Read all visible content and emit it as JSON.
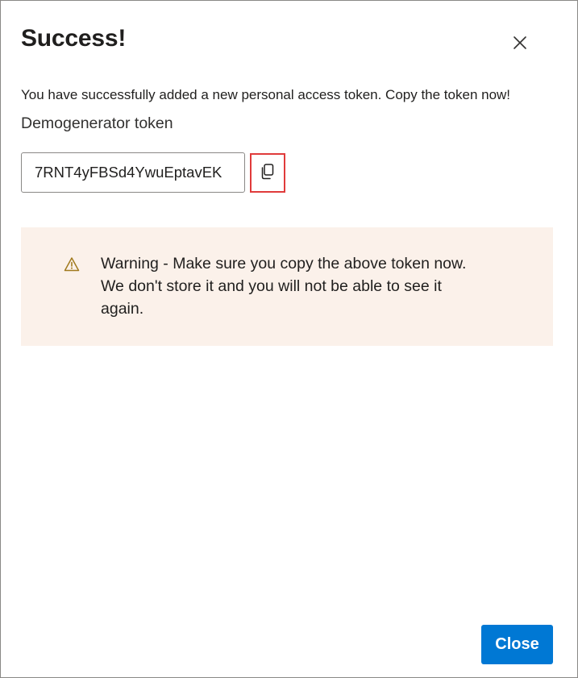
{
  "dialog": {
    "title": "Success!",
    "message": "You have successfully added a new personal access token. Copy the token now!",
    "token_name": "Demogenerator token",
    "token_value": "7RNT4yFBSd4YwuEptavEK",
    "warning": "Warning - Make sure you copy the above token now.\nWe don't store it and you will not be able to see it\nagain.",
    "close_button_label": "Close"
  },
  "icons": {
    "close": "close-x-icon",
    "copy": "copy-icon",
    "warning": "warning-triangle-icon"
  },
  "colors": {
    "primary": "#0078d4",
    "warning_background": "#fbf1ea",
    "warning_icon": "#a17a1e",
    "highlight_border": "#e03b3b"
  }
}
